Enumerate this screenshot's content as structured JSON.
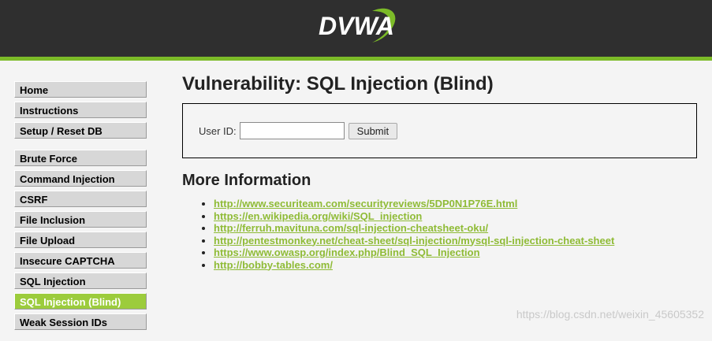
{
  "header": {
    "logo_text": "DVWA",
    "accent_color": "#7cbb28",
    "bg_color": "#2f2f2f"
  },
  "sidebar": {
    "groups": [
      [
        "Home",
        "Instructions",
        "Setup / Reset DB"
      ],
      [
        "Brute Force",
        "Command Injection",
        "CSRF",
        "File Inclusion",
        "File Upload",
        "Insecure CAPTCHA",
        "SQL Injection",
        "SQL Injection (Blind)",
        "Weak Session IDs"
      ]
    ],
    "selected": "SQL Injection (Blind)",
    "selected_color": "#9ccc3c"
  },
  "main": {
    "title": "Vulnerability: SQL Injection (Blind)",
    "form": {
      "user_label": "User ID:",
      "user_value": "",
      "submit_label": "Submit"
    },
    "more_info_title": "More Information",
    "links": [
      "http://www.securiteam.com/securityreviews/5DP0N1P76E.html",
      "https://en.wikipedia.org/wiki/SQL_injection",
      "http://ferruh.mavituna.com/sql-injection-cheatsheet-oku/",
      "http://pentestmonkey.net/cheat-sheet/sql-injection/mysql-sql-injection-cheat-sheet",
      "https://www.owasp.org/index.php/Blind_SQL_Injection",
      "http://bobby-tables.com/"
    ],
    "link_color": "#8fbb36"
  },
  "watermark": "https://blog.csdn.net/weixin_45605352"
}
